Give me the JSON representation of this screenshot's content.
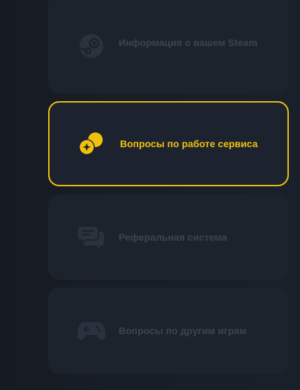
{
  "menu": {
    "items": [
      {
        "label": "Информация о вашем Steam",
        "icon": "steam-icon",
        "active": false
      },
      {
        "label": "Вопросы по работе сервиса",
        "icon": "coins-icon",
        "active": true
      },
      {
        "label": "Реферальная система",
        "icon": "chat-bubbles-icon",
        "active": false
      },
      {
        "label": "Вопросы по другим играм",
        "icon": "gamepad-icon",
        "active": false
      }
    ]
  },
  "colors": {
    "accent": "#f2c10f",
    "card_background": "#1c232d",
    "muted_text": "#3a4452",
    "page_background": "#161b22"
  }
}
